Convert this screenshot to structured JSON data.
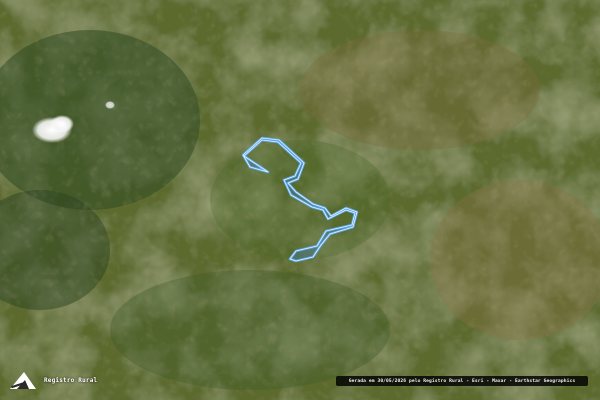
{
  "map": {
    "basemap": "satellite-imagery",
    "boundary_color": "#5aa6e8",
    "boundary_fill": "#3f78b8",
    "landcover_colors": [
      "#6b6a33",
      "#7d6b3a",
      "#4f6a2c",
      "#3f5826",
      "#8a7446"
    ]
  },
  "logo": {
    "icon": "registro-rural-logo-icon",
    "label": "Registro Rural"
  },
  "attribution": {
    "text": "Gerada em 30/05/2026 pelo Registro Rural - Esri - Maxar - Earthstar Geographics"
  }
}
